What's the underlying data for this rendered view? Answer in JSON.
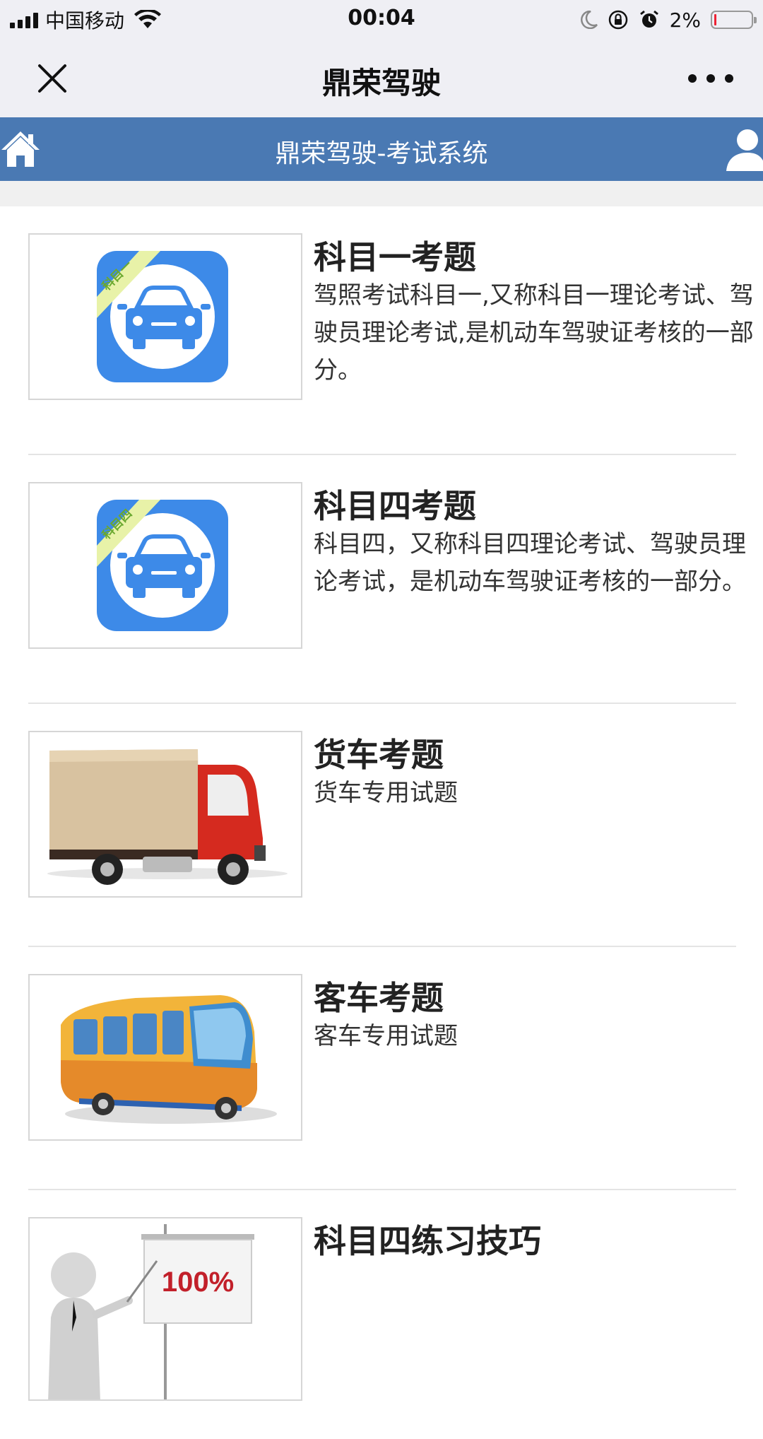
{
  "status_bar": {
    "carrier": "中国移动",
    "time": "00:04",
    "battery_percent": "2%",
    "battery_level": 0.02
  },
  "nav": {
    "title": "鼎荣驾驶",
    "close_icon": "close-icon",
    "more_icon": "more-icon"
  },
  "app_header": {
    "title": "鼎荣驾驶-考试系统",
    "home_icon": "home-icon",
    "user_icon": "user-icon"
  },
  "items": [
    {
      "title": "科目一考题",
      "description": "驾照考试科目一,又称科目一理论考试、驾驶员理论考试,是机动车驾驶证考核的一部分。",
      "image_badge": "科目一"
    },
    {
      "title": "科目四考题",
      "description": "科目四，又称科目四理论考试、驾驶员理论考试，是机动车驾驶证考核的一部分。",
      "image_badge": "科目四"
    },
    {
      "title": "货车考题",
      "description": "货车专用试题"
    },
    {
      "title": "客车考题",
      "description": "客车专用试题"
    },
    {
      "title": "科目四练习技巧",
      "image_text": "100%"
    }
  ],
  "colors": {
    "header_blue": "#4a79b3",
    "app_icon_blue": "#3d8ae8",
    "badge_green": "#e8f2a8"
  }
}
